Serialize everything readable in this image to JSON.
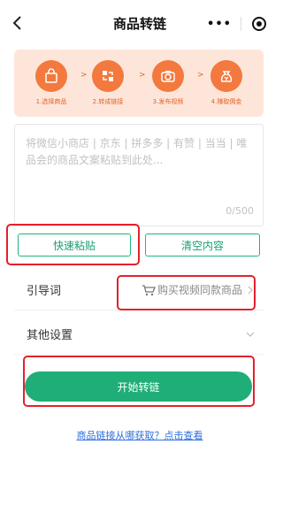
{
  "header": {
    "title": "商品转链",
    "more_label": "•••"
  },
  "steps": [
    {
      "label": "1.选择商品",
      "icon": "shopping-bag-icon"
    },
    {
      "label": "2.转成链接",
      "icon": "convert-link-icon"
    },
    {
      "label": "3.发布视频",
      "icon": "camera-icon"
    },
    {
      "label": "4.赚取佣金",
      "icon": "money-bag-icon"
    }
  ],
  "step_arrow": ">",
  "textarea": {
    "placeholder": "将微信小商店 | 京东 | 拼多多 | 有赞 | 当当 | 唯品会的商品文案粘贴到此处...",
    "counter": "0/500"
  },
  "buttons": {
    "quick_paste": "快速粘贴",
    "clear": "清空内容",
    "start": "开始转链"
  },
  "guide_row": {
    "label": "引导词",
    "value": "购买视频同款商品"
  },
  "other_row": {
    "label": "其他设置"
  },
  "help_link": "商品链接从哪获取？点击查看",
  "colors": {
    "accent_green": "#1fae78",
    "banner_bg": "#fde6d9",
    "step_orange": "#f3793e",
    "annotation_red": "#e4212b"
  }
}
